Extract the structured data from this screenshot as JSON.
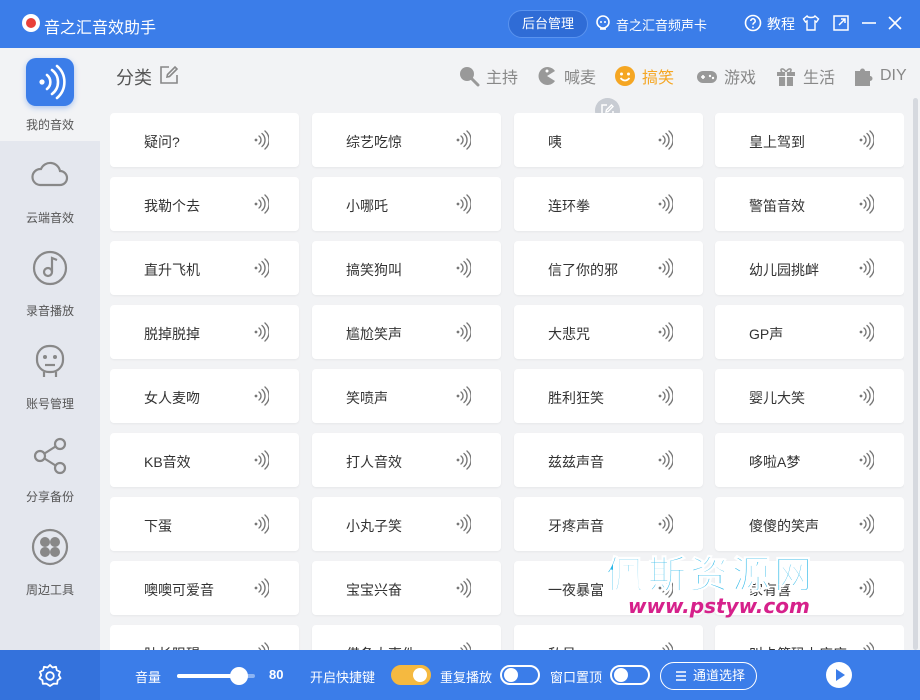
{
  "app": {
    "title": "音之汇音效助手"
  },
  "titlebar": {
    "admin_button": "后台管理",
    "device_name": "音之汇音频声卡",
    "tutorial": "教程"
  },
  "sidebar": {
    "items": [
      {
        "label": "我的音效",
        "icon": "my-sounds-icon"
      },
      {
        "label": "云端音效",
        "icon": "cloud-icon"
      },
      {
        "label": "录音播放",
        "icon": "disc-icon"
      },
      {
        "label": "账号管理",
        "icon": "account-icon"
      },
      {
        "label": "分享备份",
        "icon": "share-icon"
      },
      {
        "label": "周边工具",
        "icon": "tools-icon"
      }
    ]
  },
  "header": {
    "category_title": "分类",
    "tabs": [
      {
        "label": "主持",
        "icon": "mic-icon"
      },
      {
        "label": "喊麦",
        "icon": "pacman-icon"
      },
      {
        "label": "搞笑",
        "icon": "smile-icon",
        "active": true
      },
      {
        "label": "游戏",
        "icon": "gamepad-icon"
      },
      {
        "label": "生活",
        "icon": "gift-icon"
      },
      {
        "label": "DIY",
        "icon": "puzzle-icon"
      }
    ]
  },
  "sounds": [
    "疑问?",
    "综艺吃惊",
    "咦",
    "皇上驾到",
    "我勒个去",
    "小哪吒",
    "连环拳",
    "警笛音效",
    "直升飞机",
    "搞笑狗叫",
    "信了你的邪",
    "幼儿园挑衅",
    "脱掉脱掉",
    "尴尬笑声",
    "大悲咒",
    "GP声",
    "女人麦吻",
    "笑喷声",
    "胜利狂笑",
    "婴儿大笑",
    "KB音效",
    "打人音效",
    "兹兹声音",
    "哆啦A梦",
    "下蛋",
    "小丸子笑",
    "牙疼声音",
    "傻傻的笑声",
    "噢噢可爱音",
    "宝宝兴奋",
    "一夜暴富",
    "家有喜",
    "肚长阻碍",
    "借条大事件",
    "私员",
    "叫卡第码上店店"
  ],
  "watermark": {
    "text_cn": "佩斯资源网",
    "text_url": "www.pstyw.com"
  },
  "bottombar": {
    "volume_label": "音量",
    "volume_value": "80",
    "volume_level": 0.8,
    "shortcut_label": "开启快捷键",
    "shortcut_on": true,
    "repeat_label": "重复播放",
    "repeat_on": false,
    "pin_label": "窗口置顶",
    "pin_on": false,
    "channel_button": "通道选择"
  },
  "colors": {
    "accent": "#3b7de9",
    "active_tab": "#f5a623",
    "toggle_on": "#f5b940"
  }
}
